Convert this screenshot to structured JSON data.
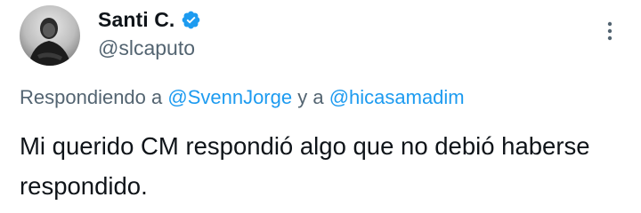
{
  "author": {
    "display_name": "Santi C.",
    "handle": "@slcaputo",
    "verified": true,
    "verified_icon": "verified-badge-icon",
    "avatar_icon": "profile-photo"
  },
  "reply_context": {
    "prefix": "Respondiendo a ",
    "mention_1": "@SvennJorge",
    "separator": " y a ",
    "mention_2": "@hicasamadim"
  },
  "tweet": {
    "text": "Mi querido CM respondió algo que no debió haberse respondido."
  },
  "menu": {
    "icon": "more-vertical-icon"
  },
  "colors": {
    "accent": "#1d9bf0",
    "text_primary": "#0f1419",
    "text_secondary": "#536471",
    "background": "#ffffff"
  }
}
